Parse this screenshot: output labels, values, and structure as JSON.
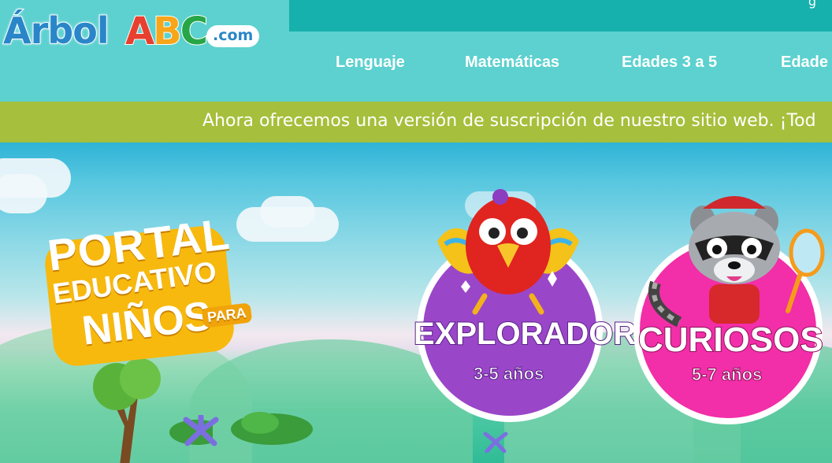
{
  "header": {
    "logo": {
      "word": "Árbol",
      "letters": [
        "A",
        "B",
        "C"
      ],
      "suffix": ".com"
    },
    "topbar_partial_text": "g"
  },
  "nav": {
    "items": [
      {
        "label": "Lenguaje"
      },
      {
        "label": "Matemáticas"
      },
      {
        "label": "Edades 3 a 5"
      },
      {
        "label": "Edade"
      }
    ]
  },
  "announcement": {
    "text": "Ahora ofrecemos una versión de suscripción de nuestro sitio web. ¡Tod"
  },
  "hero": {
    "portal": {
      "line1": "PORTAL",
      "line2": "EDUCATIVO",
      "line3": "NIÑOS",
      "line4": "PARA"
    },
    "cards": [
      {
        "title": "EXPLORADORES",
        "age": "3-5 años",
        "color": "#9a46c9"
      },
      {
        "title": "CURIOSOS",
        "age": "5-7 años",
        "color": "#f22ea8"
      }
    ]
  },
  "colors": {
    "header_bg": "#5cd1cf",
    "topbar": "#17b1ad",
    "announce_bar": "#a6bf3c",
    "logo_blue": "#2a86c9",
    "logo_a": "#e8402f",
    "logo_b": "#f7a51a",
    "logo_c": "#27a647"
  }
}
